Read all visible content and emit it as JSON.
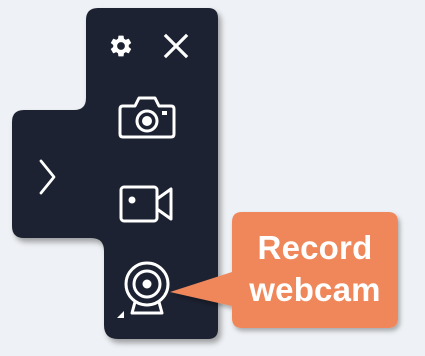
{
  "toolbar": {
    "background_color": "#1c2030",
    "icon_color": "#ffffff",
    "buttons": {
      "settings": {
        "icon": "gear-icon"
      },
      "close": {
        "icon": "close-icon"
      },
      "expand": {
        "icon": "chevron-right-icon"
      },
      "screenshot": {
        "icon": "camera-icon"
      },
      "screencast": {
        "icon": "video-camera-icon"
      },
      "webcam": {
        "icon": "webcam-icon"
      }
    }
  },
  "callout": {
    "background_color": "#f0875a",
    "line1": "Record",
    "line2": "webcam"
  }
}
